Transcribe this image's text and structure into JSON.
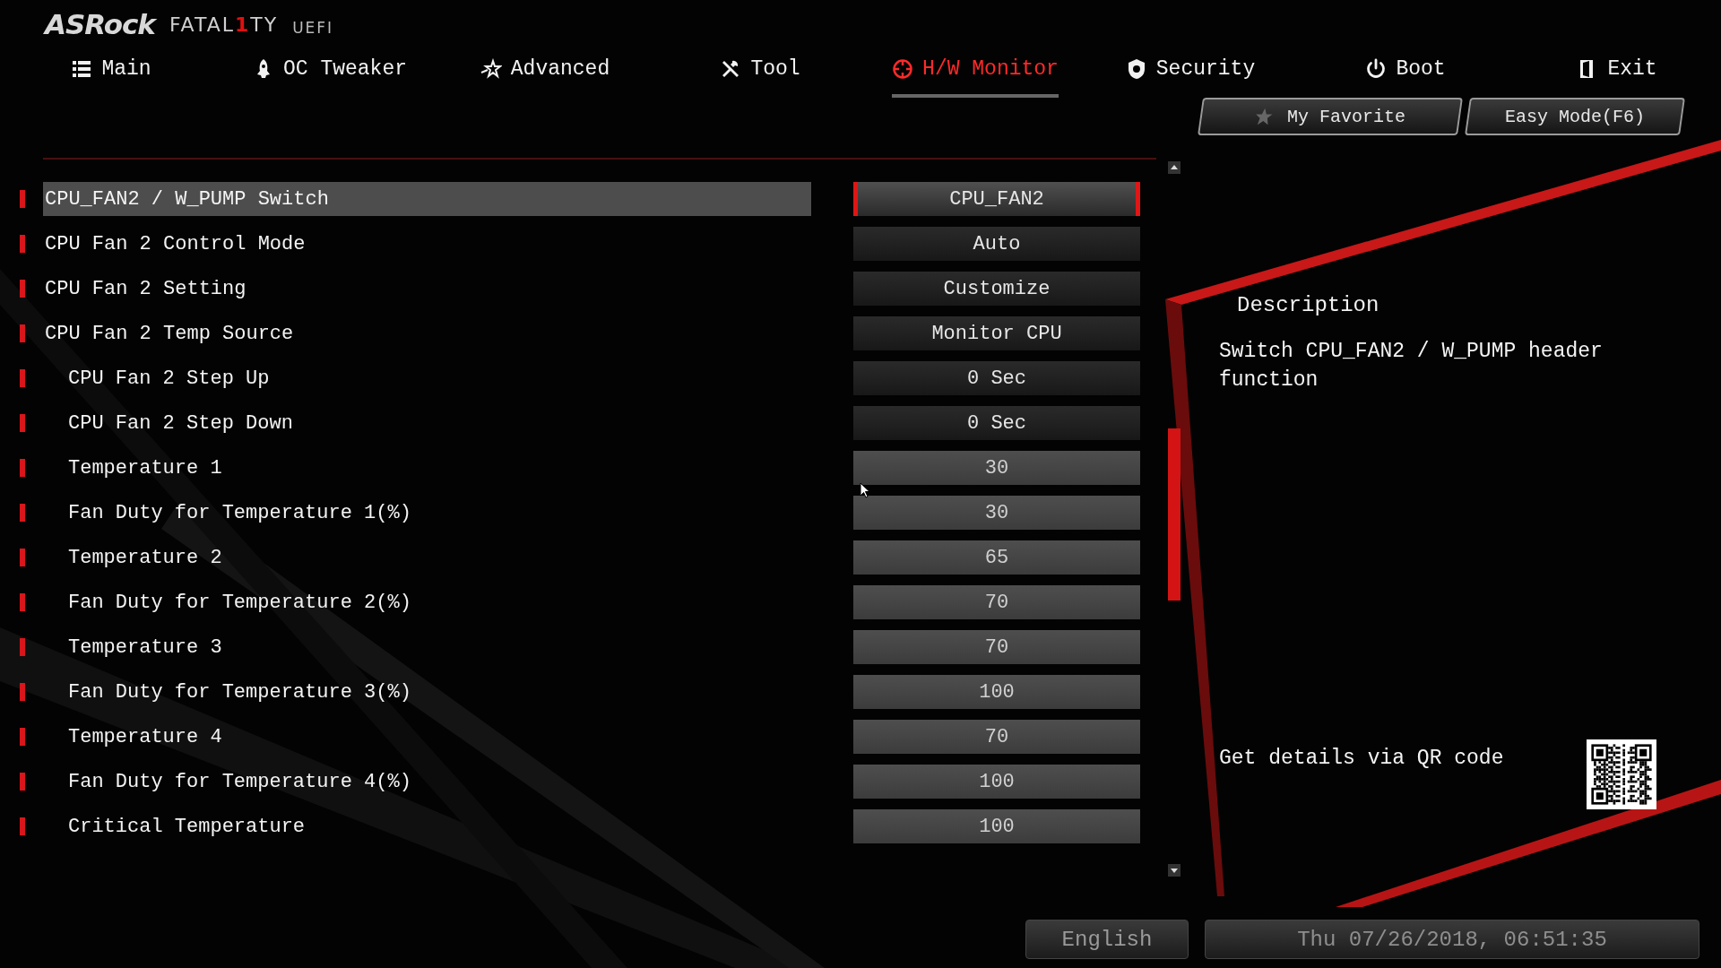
{
  "logo": {
    "brand": "ASRock",
    "product_parts": [
      {
        "text": "FATAL",
        "accent": false
      },
      {
        "text": "1",
        "accent": true
      },
      {
        "text": "TY",
        "accent": false
      }
    ],
    "suffix": "UEFI"
  },
  "nav": [
    {
      "label": "Main",
      "selected": false
    },
    {
      "label": "OC Tweaker",
      "selected": false
    },
    {
      "label": "Advanced",
      "selected": false
    },
    {
      "label": "Tool",
      "selected": false
    },
    {
      "label": "H/W Monitor",
      "selected": true
    },
    {
      "label": "Security",
      "selected": false
    },
    {
      "label": "Boot",
      "selected": false
    },
    {
      "label": "Exit",
      "selected": false
    }
  ],
  "shortcuts": [
    {
      "label": "My Favorite",
      "kind": "favorite"
    },
    {
      "label": "Easy Mode(F6)",
      "kind": "mode"
    }
  ],
  "settings": [
    {
      "label": "CPU_FAN2 / W_PUMP Switch",
      "value": "CPU_FAN2",
      "kind": "option",
      "selected": true
    },
    {
      "label": "CPU Fan 2 Control Mode",
      "value": "Auto",
      "kind": "option",
      "selected": false
    },
    {
      "label": "CPU Fan 2 Setting",
      "value": "Customize",
      "kind": "option",
      "selected": false
    },
    {
      "label": "CPU Fan 2 Temp Source",
      "value": "Monitor CPU",
      "kind": "option",
      "selected": false,
      "children": [
        {
          "label": "CPU Fan 2 Step Up",
          "value": "0 Sec",
          "kind": "option",
          "selected": false
        },
        {
          "label": "CPU Fan 2 Step Down",
          "value": "0 Sec",
          "kind": "option",
          "selected": false
        },
        {
          "label": "Temperature 1",
          "value": "30",
          "kind": "number",
          "selected": false
        },
        {
          "label": "Fan Duty for Temperature 1(%)",
          "value": "30",
          "kind": "number",
          "selected": false
        },
        {
          "label": "Temperature 2",
          "value": "65",
          "kind": "number",
          "selected": false
        },
        {
          "label": "Fan Duty for Temperature 2(%)",
          "value": "70",
          "kind": "number",
          "selected": false
        },
        {
          "label": "Temperature 3",
          "value": "70",
          "kind": "number",
          "selected": false
        },
        {
          "label": "Fan Duty for Temperature 3(%)",
          "value": "100",
          "kind": "number",
          "selected": false
        },
        {
          "label": "Temperature 4",
          "value": "70",
          "kind": "number",
          "selected": false
        },
        {
          "label": "Fan Duty for Temperature 4(%)",
          "value": "100",
          "kind": "number",
          "selected": false
        },
        {
          "label": "Critical Temperature",
          "value": "100",
          "kind": "number",
          "selected": false
        }
      ]
    }
  ],
  "description": {
    "title": "Description",
    "text": "Switch CPU_FAN2 / W_PUMP header function",
    "qr_label": "Get details via QR code"
  },
  "footer": {
    "language": "English",
    "datetime": "Thu 07/26/2018, 06:51:35"
  }
}
